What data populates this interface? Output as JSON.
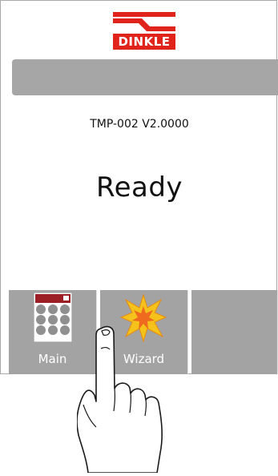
{
  "brand": {
    "name": "DINKLE",
    "red": "#e1241b"
  },
  "device": {
    "model_version": "TMP-002 V2.0000",
    "state": "Ready"
  },
  "buttons": [
    {
      "label": "Main",
      "icon": "keypad-icon"
    },
    {
      "label": "Wizard",
      "icon": "starburst-icon"
    },
    {
      "label": ""
    }
  ],
  "colors": {
    "panel_gray": "#a6a6a6",
    "button_gray": "#a3a3a3",
    "keypad_dark_red": "#9c1f25"
  },
  "overlay": {
    "icon": "pointing-hand-icon"
  }
}
